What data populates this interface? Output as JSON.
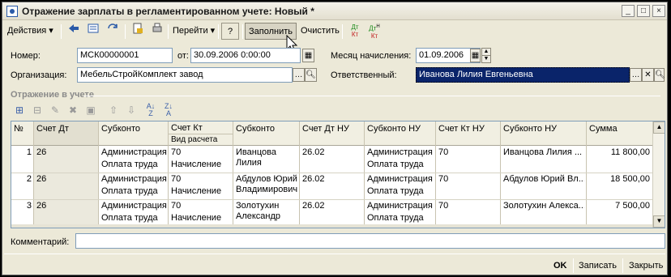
{
  "window": {
    "title": "Отражение зарплаты в регламентированном учете: Новый *",
    "controls": [
      "_",
      "□",
      "×"
    ]
  },
  "toolbar": {
    "actions_label": "Действия",
    "goto_label": "Перейти",
    "help_label": "?",
    "fill_label": "Заполнить",
    "clear_label": "Очистить",
    "dt_label": "Дт",
    "kt_label": "Кт",
    "dtn_label": "Дт",
    "ktn_label": "Кт",
    "n_label": "Н"
  },
  "form": {
    "number_label": "Номер:",
    "number_value": "МСК00000001",
    "date_label": "от:",
    "date_value": "30.09.2006  0:00:00",
    "org_label": "Организация:",
    "org_value": "МебельСтройКомплект завод",
    "month_label": "Месяц начисления:",
    "month_value": "01.09.2006",
    "resp_label": "Ответственный:",
    "resp_value": "Иванова Лилия Евгеньевна",
    "comment_label": "Комментарий:",
    "comment_value": ""
  },
  "section": {
    "title": "Отражение в учете"
  },
  "grid": {
    "headers": {
      "num": "№",
      "acct_dt": "Счет Дт",
      "sub1": "Субконто",
      "acct_kt": "Счет Кт",
      "calc_kind": "Вид расчета",
      "sub2": "Субконто",
      "acct_dt_nu": "Счет Дт НУ",
      "sub_nu1": "Субконто НУ",
      "acct_kt_nu": "Счет Кт НУ",
      "sub_nu2": "Субконто НУ",
      "sum": "Сумма"
    },
    "rows": [
      {
        "num": "1",
        "acct_dt": "26",
        "sub1a": "Администрация",
        "sub1b": "Оплата труда",
        "acct_kt": "70",
        "calc": "Начисление",
        "sub2a": "Иванцова",
        "sub2b": "Лилия",
        "acct_dt_nu": "26.02",
        "sub_nu1a": "Администрация",
        "sub_nu1b": "Оплата труда",
        "acct_kt_nu": "70",
        "sub_nu2": "Иванцова Лилия ...",
        "sum": "11 800,00"
      },
      {
        "num": "2",
        "acct_dt": "26",
        "sub1a": "Администрация",
        "sub1b": "Оплата труда",
        "acct_kt": "70",
        "calc": "Начисление",
        "sub2a": "Абдулов Юрий",
        "sub2b": "Владимирович",
        "acct_dt_nu": "26.02",
        "sub_nu1a": "Администрация",
        "sub_nu1b": "Оплата труда",
        "acct_kt_nu": "70",
        "sub_nu2": "Абдулов Юрий Вл...",
        "sum": "18 500,00"
      },
      {
        "num": "3",
        "acct_dt": "26",
        "sub1a": "Администрация",
        "sub1b": "Оплата труда",
        "acct_kt": "70",
        "calc": "Начисление",
        "sub2a": "Золотухин",
        "sub2b": "Александр",
        "acct_dt_nu": "26.02",
        "sub_nu1a": "Администрация",
        "sub_nu1b": "Оплата труда",
        "acct_kt_nu": "70",
        "sub_nu2": "Золотухин Алекса...",
        "sum": "7 500,00"
      }
    ]
  },
  "footer": {
    "ok_label": "OK",
    "save_label": "Записать",
    "close_label": "Закрыть"
  }
}
